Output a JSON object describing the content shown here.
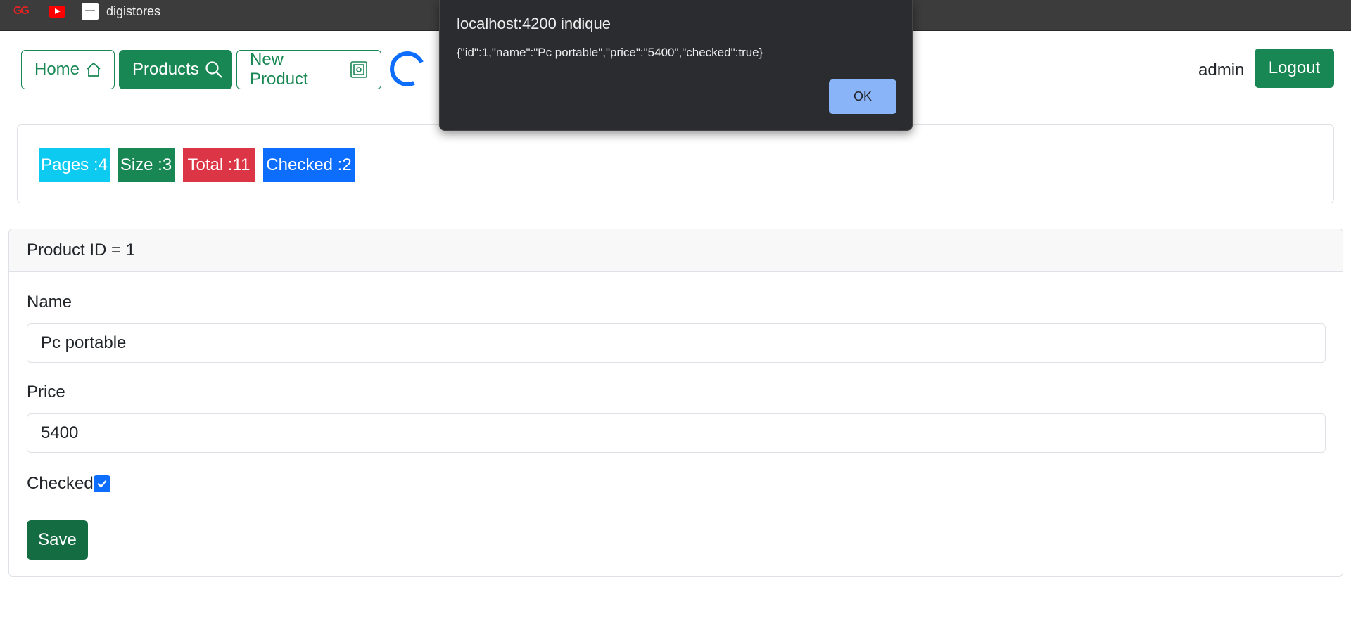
{
  "bookmarks": [
    {
      "label": "GG"
    },
    {
      "label": ""
    },
    {
      "label": "digistores"
    }
  ],
  "nav": {
    "home": "Home",
    "products": "Products",
    "new_product": "New Product",
    "user": "admin",
    "logout": "Logout"
  },
  "stats": {
    "pages": "Pages :4",
    "size": "Size :3",
    "total": "Total :11",
    "checked": "Checked :2"
  },
  "product": {
    "header": "Product ID = 1",
    "name_label": "Name",
    "name_value": "Pc portable",
    "price_label": "Price",
    "price_value": "5400",
    "checked_label": "Checked",
    "checked": true,
    "save": "Save"
  },
  "dialog": {
    "title": "localhost:4200 indique",
    "message": "{\"id\":1,\"name\":\"Pc portable\",\"price\":\"5400\",\"checked\":true}",
    "ok": "OK"
  },
  "colors": {
    "success": "#198754",
    "info": "#0dcaf0",
    "danger": "#dc3545",
    "primary": "#0d6efd"
  }
}
